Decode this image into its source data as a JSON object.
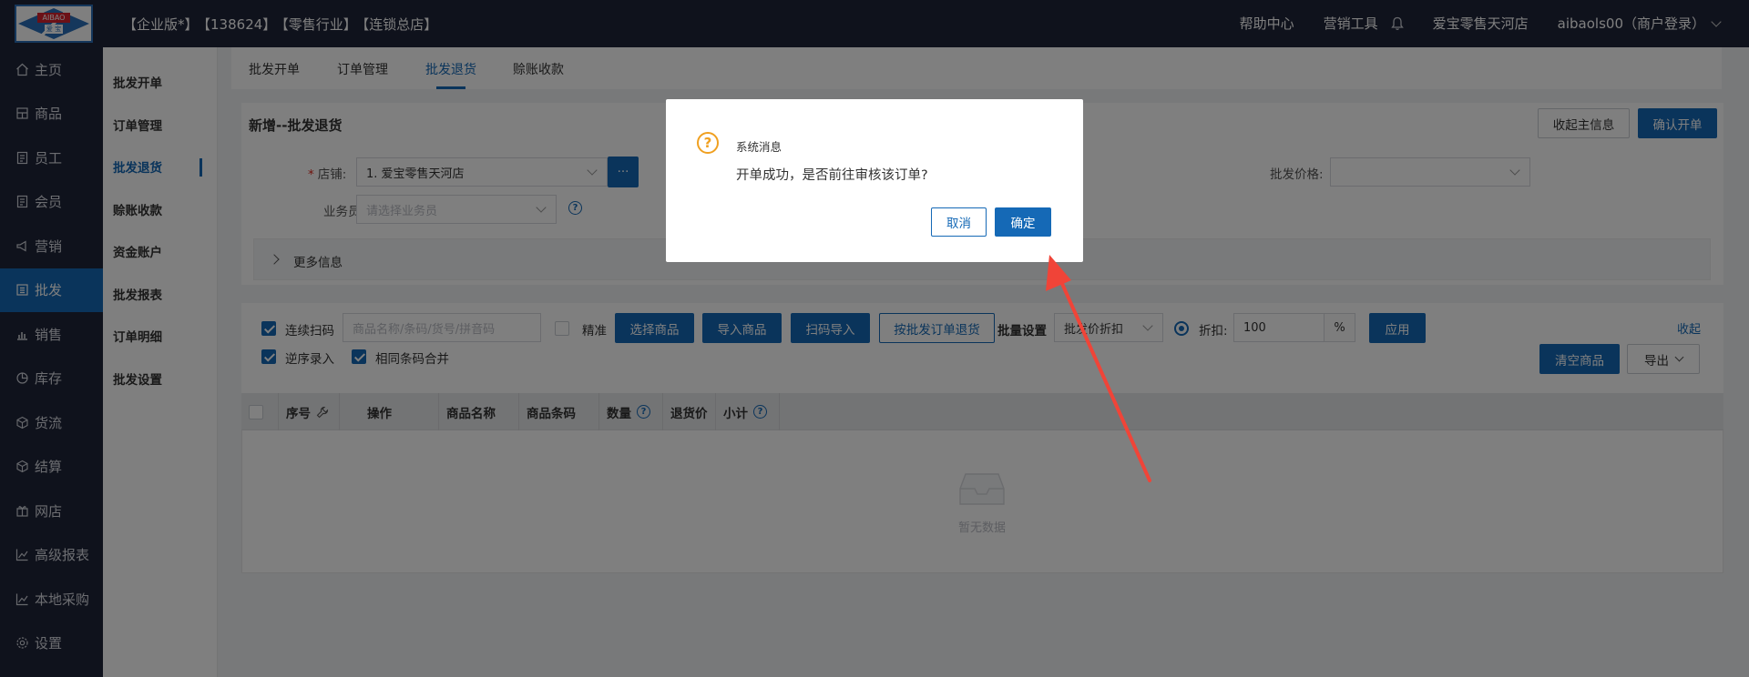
{
  "header": {
    "edition": "【企业版*】",
    "account_no": "【138624】",
    "industry": "【零售行业】",
    "store_type": "【连锁总店】",
    "help": "帮助中心",
    "marketing_tools": "营销工具",
    "store_name": "爱宝零售天河店",
    "user": "aibaols00（商户登录）"
  },
  "logo": {
    "en": "AIBAO",
    "cn": "爱 宝"
  },
  "nav": {
    "items": [
      {
        "label": "主页",
        "icon": "home-icon"
      },
      {
        "label": "商品",
        "icon": "goods-icon"
      },
      {
        "label": "员工",
        "icon": "staff-icon"
      },
      {
        "label": "会员",
        "icon": "member-icon"
      },
      {
        "label": "营销",
        "icon": "megaphone-icon"
      },
      {
        "label": "批发",
        "icon": "wholesale-icon"
      },
      {
        "label": "销售",
        "icon": "sales-chart-icon"
      },
      {
        "label": "库存",
        "icon": "inventory-icon"
      },
      {
        "label": "货流",
        "icon": "cube-icon"
      },
      {
        "label": "结算",
        "icon": "settle-icon"
      },
      {
        "label": "网店",
        "icon": "gift-icon"
      },
      {
        "label": "高级报表",
        "icon": "line-chart-icon"
      },
      {
        "label": "本地采购",
        "icon": "line-chart-icon"
      },
      {
        "label": "设置",
        "icon": "gear-icon"
      }
    ],
    "active_index": 5
  },
  "subnav": {
    "items": [
      "批发开单",
      "订单管理",
      "批发退货",
      "赊账收款",
      "资金账户",
      "批发报表",
      "订单明细",
      "批发设置"
    ],
    "active_index": 2
  },
  "tabs": [
    "批发开单",
    "订单管理",
    "批发退货",
    "赊账收款"
  ],
  "form": {
    "title": "新增--批发退货",
    "collapse_main_label": "收起主信息",
    "confirm_label": "确认开单",
    "store_label": "店铺:",
    "store_value": "1. 爱宝零售天河店",
    "ellipsis": "···",
    "salesman_label": "业务员:",
    "salesman_placeholder": "请选择业务员",
    "wholesale_price_label": "批发价格:",
    "more_info": "更多信息"
  },
  "toolbar": {
    "continuous_scan": "连续扫码",
    "search_placeholder": "商品名称/条码/货号/拼音码",
    "exact": "精准",
    "select_goods": "选择商品",
    "import_goods": "导入商品",
    "scan_import": "扫码导入",
    "return_by_order": "按批发订单退货",
    "batch_setting": "批量设置",
    "price_discount": "批发价折扣",
    "discount_label": "折扣:",
    "discount_value": "100",
    "percent": "%",
    "apply": "应用",
    "collapse": "收起",
    "reverse_entry": "逆序录入",
    "merge_same_barcode": "相同条码合并",
    "clear_goods": "清空商品",
    "export": "导出"
  },
  "table": {
    "columns": [
      "序号",
      "操作",
      "商品名称",
      "商品条码",
      "数量",
      "退货价",
      "小计"
    ],
    "empty_text": "暂无数据"
  },
  "dialog": {
    "title": "系统消息",
    "message": "开单成功，是否前往审核该订单?",
    "cancel": "取消",
    "ok": "确定"
  },
  "colors": {
    "primary": "#1569b6",
    "nav_bg": "#1f2438",
    "annotation_arrow": "#f04438"
  }
}
